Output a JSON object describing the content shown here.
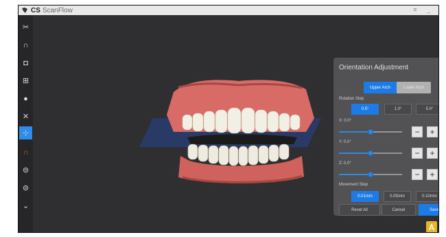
{
  "app": {
    "brand": "CS",
    "name": "ScanFlow",
    "window_controls": "≡ _"
  },
  "toolbar": [
    {
      "name": "trim-tool-icon",
      "glyph": "✂"
    },
    {
      "name": "arch-icon",
      "glyph": "∩"
    },
    {
      "name": "view-box-icon",
      "glyph": "◘"
    },
    {
      "name": "tooth-tag-icon",
      "glyph": "⊞"
    },
    {
      "name": "shade-sphere-icon",
      "glyph": "●"
    },
    {
      "name": "tools-cross-icon",
      "glyph": "✕"
    },
    {
      "name": "orientation-axes-icon",
      "glyph": "⊹"
    },
    {
      "name": "arch-outline-icon",
      "glyph": "∩"
    },
    {
      "name": "bite-upper-icon",
      "glyph": "⊜"
    },
    {
      "name": "bite-lower-icon",
      "glyph": "⊜"
    },
    {
      "name": "collapse-icon",
      "glyph": "⌄"
    }
  ],
  "panel": {
    "title": "Orientation Adjustment",
    "close_glyph": ">",
    "arch_tabs": [
      {
        "label": "Upper Arch",
        "selected": true
      },
      {
        "label": "Lower Arch",
        "selected": false
      }
    ],
    "rotation_step_label": "Rotation Step",
    "rotation_steps": [
      {
        "label": "0.5°",
        "selected": true
      },
      {
        "label": "1.0°",
        "selected": false
      },
      {
        "label": "5.0°",
        "selected": false
      }
    ],
    "axes": [
      {
        "label": "X:  0.0°",
        "level": 0.5
      },
      {
        "label": "Y:  0.0°",
        "level": 0.5
      },
      {
        "label": "Z:  0.0°",
        "level": 0.5
      }
    ],
    "minus_glyph": "−",
    "plus_glyph": "+",
    "undo_glyph": "U",
    "movement_step_label": "Movement Step",
    "movement_steps": [
      {
        "label": "0.01mm",
        "selected": true
      },
      {
        "label": "0.05mm",
        "selected": false
      },
      {
        "label": "0.10mm",
        "selected": false
      }
    ],
    "actions": {
      "reset": "Reset All",
      "cancel": "Cancel",
      "save": "Save"
    }
  },
  "badge": "A",
  "colors": {
    "accent": "#2c8ee8",
    "panel_bg": "#545456",
    "viewport_bg": "#2f2f31"
  }
}
